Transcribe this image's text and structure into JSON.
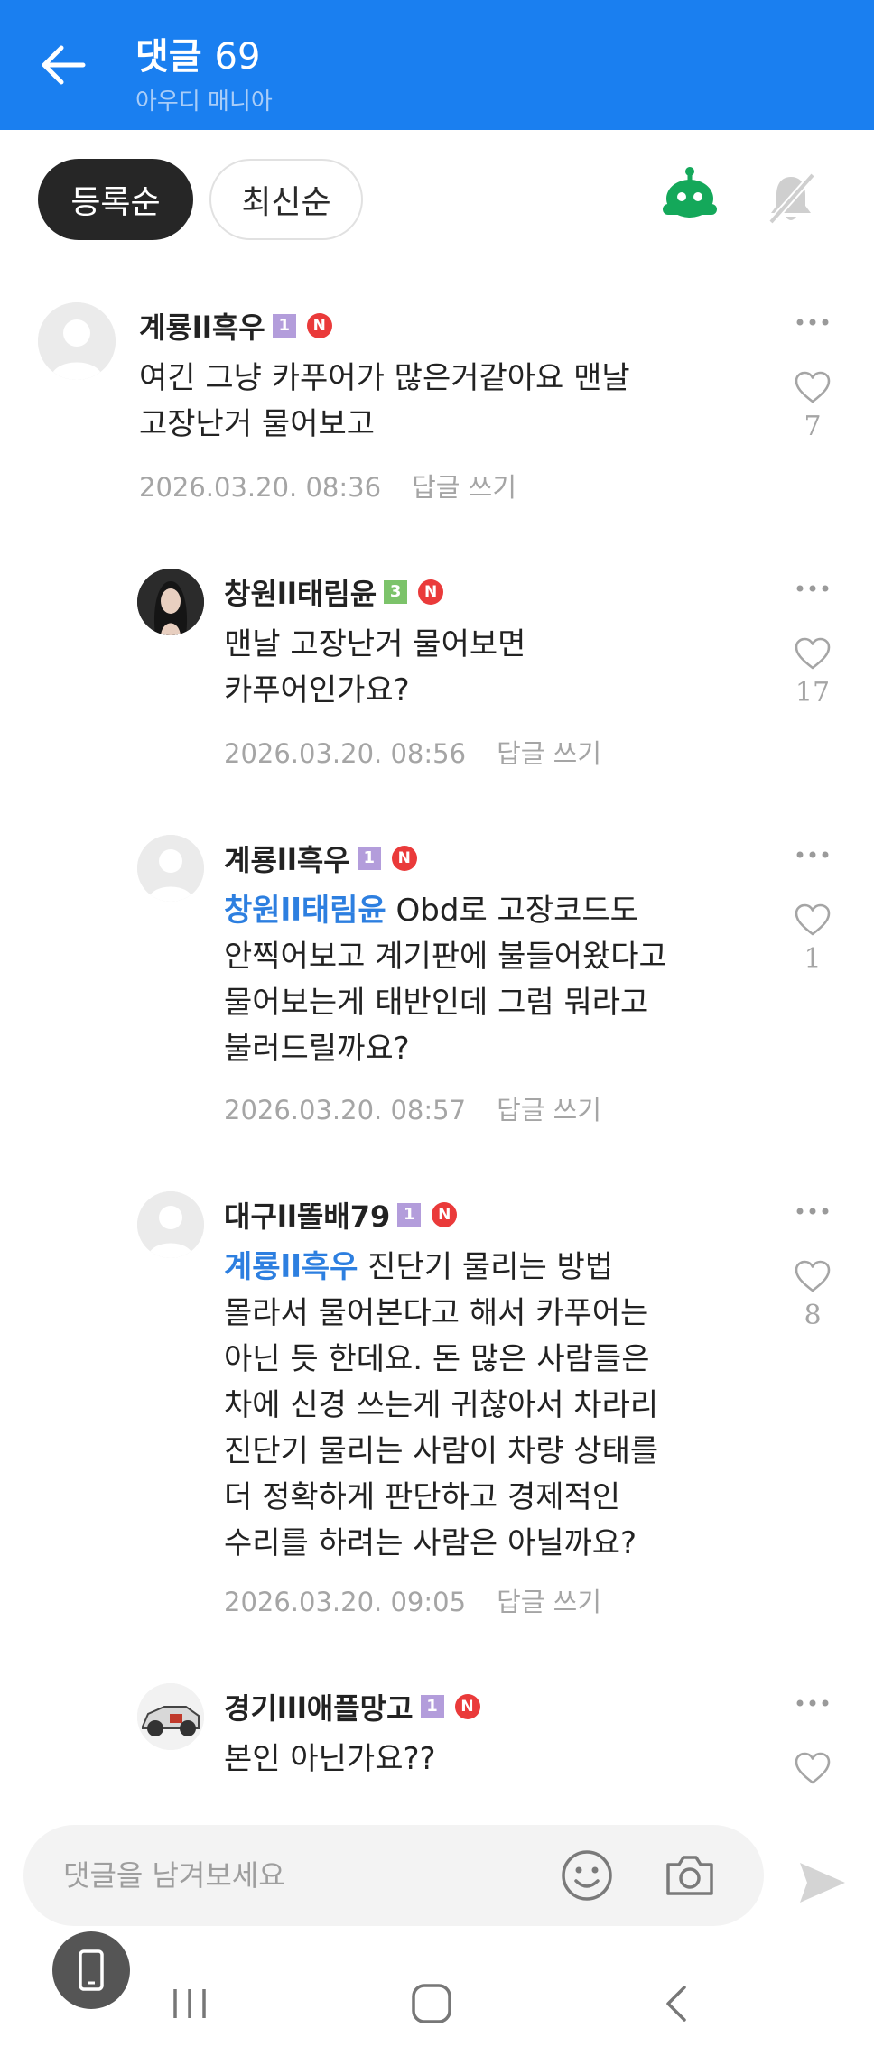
{
  "header": {
    "title": "댓글",
    "count": "69",
    "subtitle": "아우디 매니아"
  },
  "sort": {
    "active": "등록순",
    "inactive": "최신순"
  },
  "comments": [
    {
      "author": "계룡ll흑우",
      "level": "1",
      "badge": "N",
      "mention": "",
      "line1": "여긴 그냥 카푸어가 많은거같아요 맨날",
      "lines": [
        "고장난거 물어보고"
      ],
      "date": "2026.03.20. 08:36",
      "reply": "답글 쓰기",
      "likes": "7"
    },
    {
      "author": "창원ll태림윤",
      "level": "3",
      "badge": "N",
      "mention": "",
      "line1": "맨날 고장난거 물어보면",
      "lines": [
        "카푸어인가요?"
      ],
      "date": "2026.03.20. 08:56",
      "reply": "답글 쓰기",
      "likes": "17"
    },
    {
      "author": "계룡ll흑우",
      "level": "1",
      "badge": "N",
      "mention": "창원ll태림윤",
      "line1": " Obd로 고장코드도",
      "lines": [
        "안찍어보고 계기판에 불들어왔다고",
        "물어보는게 태반인데 그럼 뭐라고",
        "불러드릴까요?"
      ],
      "date": "2026.03.20. 08:57",
      "reply": "답글 쓰기",
      "likes": "1"
    },
    {
      "author": "대구ll똘배79",
      "level": "1",
      "badge": "N",
      "mention": "계룡ll흑우",
      "line1": " 진단기 물리는 방법",
      "lines": [
        "몰라서 물어본다고 해서 카푸어는",
        "아닌 듯 한데요. 돈 많은 사람들은",
        "차에 신경 쓰는게 귀찮아서 차라리",
        "진단기 물리는 사람이 차량 상태를",
        "더 정확하게 판단하고 경제적인",
        "수리를 하려는 사람은 아닐까요?"
      ],
      "date": "2026.03.20. 09:05",
      "reply": "답글 쓰기",
      "likes": "8"
    },
    {
      "author": "경기lll애플망고",
      "level": "1",
      "badge": "N",
      "mention": "",
      "line1": "본인 아닌가요??",
      "lines": [],
      "date": "",
      "reply": "",
      "likes": ""
    }
  ],
  "input": {
    "placeholder": "댓글을 남겨보세요"
  },
  "icons": {
    "back": "arrow-left-icon",
    "robot": "robot-icon",
    "bell": "bell-off-icon",
    "more": "more-dots-icon",
    "like": "heart-icon",
    "emoji": "smiley-icon",
    "camera": "camera-icon",
    "send": "send-icon"
  },
  "colors": {
    "header_bg": "#1a7ff0",
    "mention": "#2d7fe0",
    "robot": "#14a85a",
    "badge_n": "#ea3a3a"
  }
}
